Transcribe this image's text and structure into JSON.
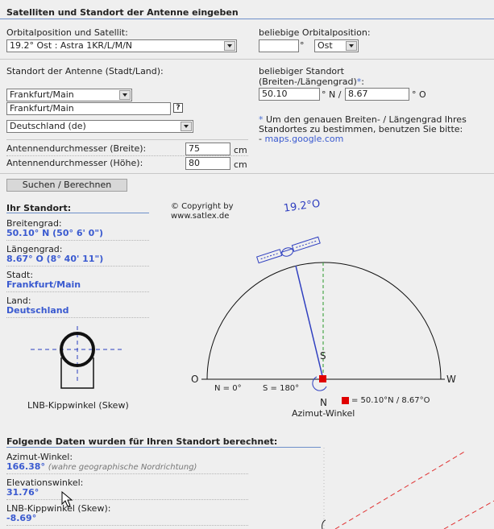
{
  "header": {
    "title": "Satelliten und Standort der Antenne eingeben"
  },
  "form": {
    "orbital_label": "Orbitalposition und Satellit:",
    "orbital_value": "19.2° Ost : Astra 1KR/L/M/N",
    "custom_orbital_label": "beliebige Orbitalposition:",
    "custom_orbital_value": "",
    "degree_unit": "°",
    "direction_value": "Ost",
    "location_label": "Standort der Antenne (Stadt/Land):",
    "city_select": "Frankfurt/Main",
    "city_input": "Frankfurt/Main",
    "help_symbol": "?",
    "country_select": "Deutschland (de)",
    "custom_location_label": "beliebiger Standort",
    "custom_location_sub": "(Breiten-/Längengrad)",
    "star": "*",
    "lat_value": "50.10",
    "lat_unit": "° N /",
    "lon_value": "8.67",
    "lon_unit": "° O",
    "note_star": "*",
    "note_line1": "Um den genauen Breiten- / Längengrad Ihres",
    "note_line2": "Standortes zu bestimmen, benutzen Sie bitte:",
    "note_dash": "- ",
    "note_link": "maps.google.com",
    "width_label": "Antennendurchmesser (Breite):",
    "width_value": "75",
    "height_label": "Antennendurchmesser (Höhe):",
    "height_value": "80",
    "cm_unit": "cm",
    "submit_label": "Suchen / Berechnen"
  },
  "location_info": {
    "title": "Ihr Standort:",
    "lat_label": "Breitengrad:",
    "lat_value": "50.10° N (50° 6' 0\")",
    "lon_label": "Längengrad:",
    "lon_value": "8.67° O (8° 40' 11\")",
    "city_label": "Stadt:",
    "city_value": "Frankfurt/Main",
    "country_label": "Land:",
    "country_value": "Deutschland",
    "skew_caption": "LNB-Kippwinkel (Skew)"
  },
  "diagram": {
    "copyright_line1": "© Copyright by",
    "copyright_line2": "www.satlex.de",
    "satellite_label": "19.2°O",
    "west": "W",
    "east": "O",
    "south": "S",
    "north": "N",
    "n_value": "N = 0°",
    "s_value": "S = 180°",
    "azimuth_caption": "Azimut-Winkel",
    "position_text": "= 50.10°N / 8.67°O",
    "colors": {
      "satellite": "#3040c0",
      "marker": "#e00000",
      "dashed_green": "#2a9a2a"
    }
  },
  "results": {
    "title": "Folgende Daten wurden für Ihren Standort berechnet:",
    "azimut_label": "Azimut-Winkel:",
    "azimut_value": "166.38°",
    "azimut_note": "(wahre geographische Nordrichtung)",
    "elevation_label": "Elevationswinkel:",
    "elevation_value": "31.76°",
    "skew_label": "LNB-Kippwinkel (Skew):",
    "skew_value": "-8.69°"
  }
}
